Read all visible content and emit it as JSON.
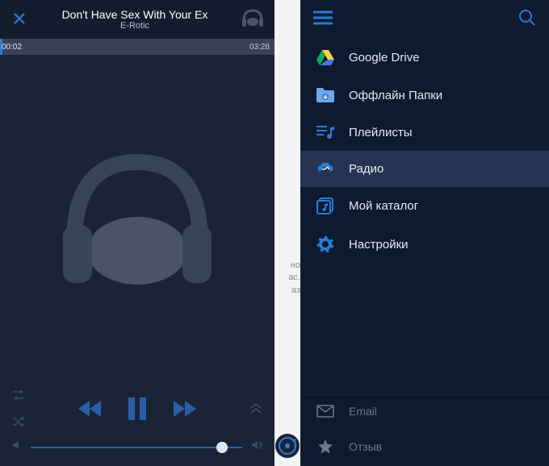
{
  "player": {
    "track_title": "Don't Have Sex With Your Ex",
    "track_artist": "E-Rotic",
    "time_elapsed": "00:02",
    "time_total": "03:28"
  },
  "peek": {
    "line1": "но",
    "line2": "ас.",
    "line3": "аз"
  },
  "menu": {
    "items": [
      {
        "label": "Google Drive",
        "icon": "google-drive-icon"
      },
      {
        "label": "Оффлайн Папки",
        "icon": "folder-icon"
      },
      {
        "label": "Плейлисты",
        "icon": "playlists-icon"
      },
      {
        "label": "Радио",
        "icon": "radio-icon",
        "selected": true
      },
      {
        "label": "Мой каталог",
        "icon": "catalog-icon"
      },
      {
        "label": "Настройки",
        "icon": "settings-icon"
      }
    ],
    "footer": [
      {
        "label": "Email",
        "icon": "email-icon"
      },
      {
        "label": "Отзыв",
        "icon": "star-icon"
      }
    ]
  }
}
